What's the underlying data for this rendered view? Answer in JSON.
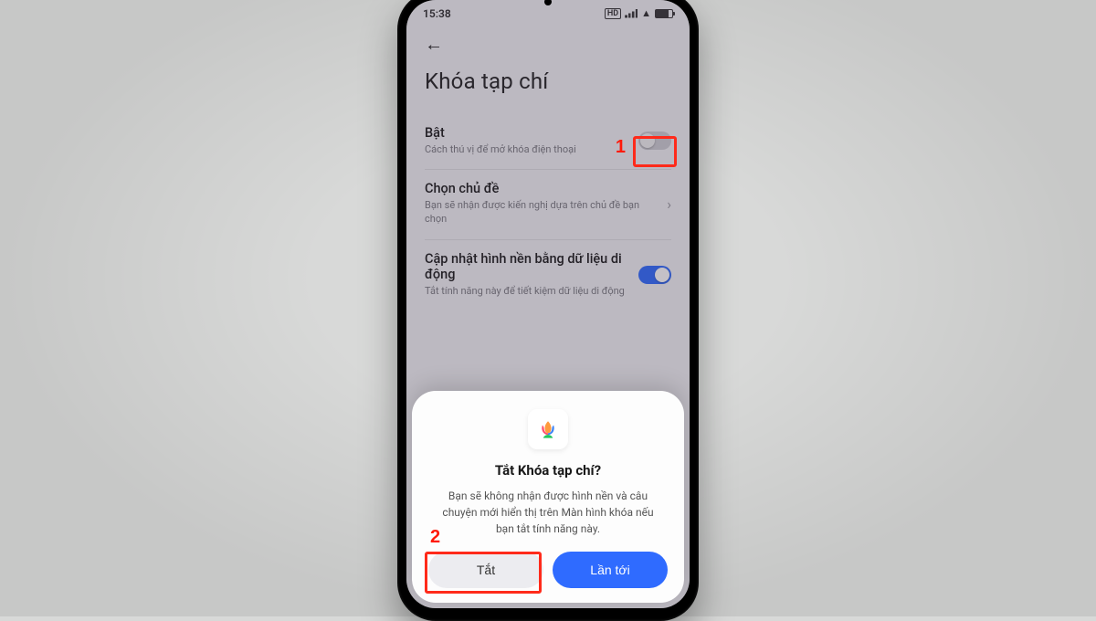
{
  "statusbar": {
    "time": "15:38"
  },
  "page": {
    "title": "Khóa tạp chí",
    "rows": {
      "enable": {
        "title": "Bật",
        "sub": "Cách thú vị để mở khóa điện thoại"
      },
      "theme": {
        "title": "Chọn chủ đề",
        "sub": "Bạn sẽ nhận được kiến nghị dựa trên chủ đề bạn chọn"
      },
      "mobiledata": {
        "title": "Cập nhật hình nền bằng dữ liệu di động",
        "sub": "Tắt tính năng này để tiết kiệm dữ liệu di động"
      }
    }
  },
  "dialog": {
    "title": "Tắt Khóa tạp chí?",
    "body": "Bạn sẽ không nhận được hình nền và câu chuyện mới hiển thị trên Màn hình khóa nếu bạn tắt tính năng này.",
    "secondary": "Tắt",
    "primary": "Lần tới"
  },
  "annotations": {
    "one": "1",
    "two": "2"
  }
}
